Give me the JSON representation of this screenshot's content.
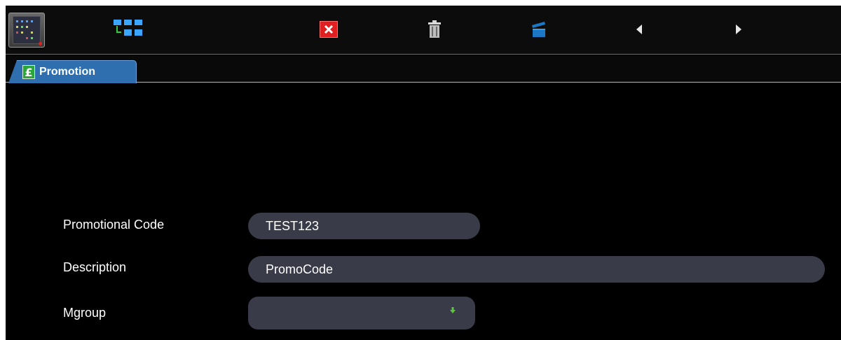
{
  "toolbar": {
    "icons": {
      "app": "app-launcher-icon",
      "layout": "layout-grid-icon",
      "close": "close-icon",
      "delete": "trash-icon",
      "clapper": "clapperboard-icon",
      "prev": "triangle-left-icon",
      "next": "triangle-right-icon"
    },
    "colors": {
      "close_bg": "#e02020",
      "clapper": "#1c78c4",
      "grid_blue": "#3aa6ff",
      "grid_green": "#2ecc40"
    }
  },
  "tabs": [
    {
      "label": "Promotion",
      "icon": "£"
    }
  ],
  "form": {
    "promo_code": {
      "label": "Promotional Code",
      "value": "TEST123"
    },
    "description": {
      "label": "Description",
      "value": "PromoCode"
    },
    "mgroup": {
      "label": "Mgroup",
      "value": ""
    }
  },
  "colors": {
    "background": "#000000",
    "tab_active": "#2f6fb0",
    "field_bg": "#3a3b49",
    "dropdown_arrow": "#59c73b"
  }
}
